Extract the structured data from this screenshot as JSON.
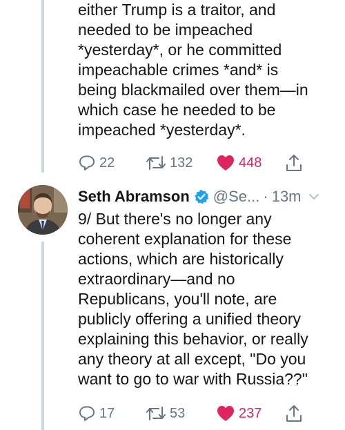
{
  "tweets": [
    {
      "text": "either Trump is a traitor, and\nneeded to be impeached\n*yesterday*, or he committed\nimpeachable crimes *and* is\nbeing blackmailed over them—in\nwhich case he needed to be\nimpeached *yesterday*.",
      "actions": {
        "replies": "22",
        "retweets": "132",
        "likes": "448"
      }
    },
    {
      "author": {
        "name": "Seth Abramson",
        "handle": "@Se...",
        "time": "13m",
        "separator": "·"
      },
      "text": "9/ But there's no longer any\ncoherent explanation for these\nactions, which are historically\nextraordinary—and no\nRepublicans, you'll note, are\npublicly offering a unified theory\nexplaining this behavior, or really\nany theory at all except, \"Do you\nwant to go to war with Russia??\"",
      "actions": {
        "replies": "17",
        "retweets": "53",
        "likes": "237"
      }
    }
  ],
  "colors": {
    "text": "#14171a",
    "secondary": "#657786",
    "like": "#e0245e",
    "verified": "#1da1f2",
    "thread_line": "#ccd6dd"
  },
  "icons": [
    "reply-icon",
    "retweet-icon",
    "like-icon",
    "share-icon",
    "verified-badge-icon",
    "chevron-down-icon"
  ]
}
